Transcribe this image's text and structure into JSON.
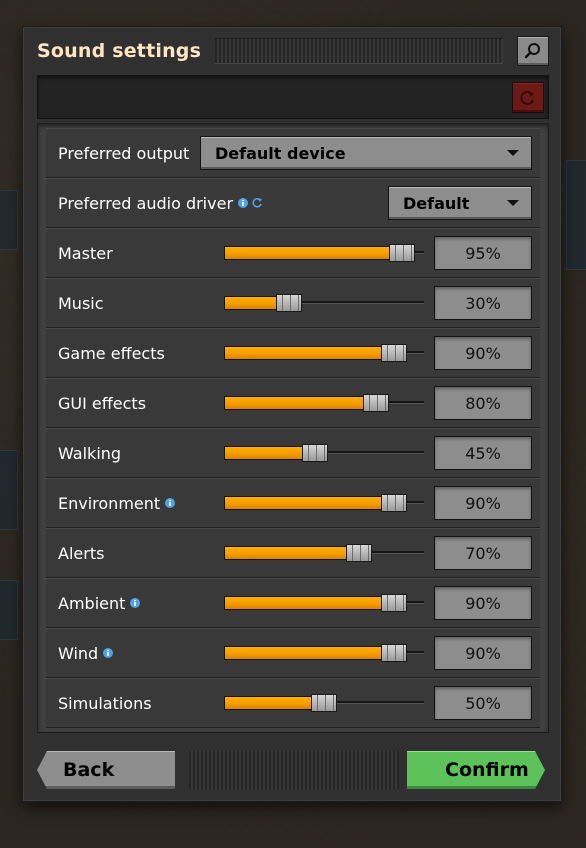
{
  "window": {
    "title": "Sound settings"
  },
  "buttons": {
    "back": "Back",
    "confirm": "Confirm"
  },
  "settings": {
    "preferred_output": {
      "label": "Preferred output",
      "value": "Default device"
    },
    "preferred_audio_driver": {
      "label": "Preferred audio driver",
      "value": "Default"
    }
  },
  "sliders": [
    {
      "label": "Master",
      "percent": 95,
      "display": "95%",
      "info": false
    },
    {
      "label": "Music",
      "percent": 30,
      "display": "30%",
      "info": false
    },
    {
      "label": "Game effects",
      "percent": 90,
      "display": "90%",
      "info": false
    },
    {
      "label": "GUI effects",
      "percent": 80,
      "display": "80%",
      "info": false
    },
    {
      "label": "Walking",
      "percent": 45,
      "display": "45%",
      "info": false
    },
    {
      "label": "Environment",
      "percent": 90,
      "display": "90%",
      "info": true
    },
    {
      "label": "Alerts",
      "percent": 70,
      "display": "70%",
      "info": false
    },
    {
      "label": "Ambient",
      "percent": 90,
      "display": "90%",
      "info": true
    },
    {
      "label": "Wind",
      "percent": 90,
      "display": "90%",
      "info": true
    },
    {
      "label": "Simulations",
      "percent": 50,
      "display": "50%",
      "info": false
    }
  ],
  "colors": {
    "title": "#ffe6c0",
    "slider_fill": "#f7a300",
    "confirm": "#5dc25a",
    "info_icon": "#4fa3e6",
    "reset_button": "#6b1a17"
  },
  "icons": {
    "search": "magnifier-icon",
    "reset": "reset-icon",
    "info": "info-icon",
    "refresh": "refresh-icon",
    "dropdown": "chevron-down-icon"
  }
}
